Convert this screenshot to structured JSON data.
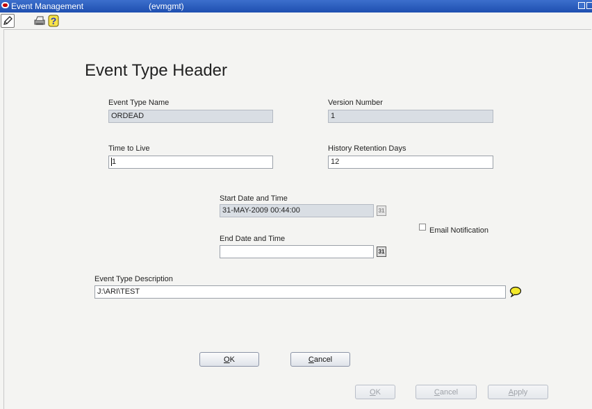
{
  "window": {
    "title": "Event Management",
    "code": "(evmgmt)"
  },
  "toolbar": {
    "items": [
      {
        "icon": "edit-icon"
      },
      {
        "icon": "printer-icon"
      },
      {
        "icon": "help-icon",
        "glyph": "?"
      }
    ]
  },
  "form": {
    "heading": "Event Type Header",
    "event_type_name": {
      "label": "Event Type Name",
      "value": "ORDEAD"
    },
    "version_number": {
      "label": "Version Number",
      "value": "1"
    },
    "time_to_live": {
      "label": "Time to Live",
      "value": "1"
    },
    "history_retention_days": {
      "label": "History Retention Days",
      "value": "12"
    },
    "start_date_time": {
      "label": "Start Date and Time",
      "value": "31-MAY-2009 00:44:00"
    },
    "email_notification": {
      "label": "Email Notification",
      "checked": false
    },
    "end_date_time": {
      "label": "End Date and Time",
      "value": ""
    },
    "description": {
      "label": "Event Type Description",
      "value": "J:\\ARI\\TEST"
    },
    "calendar_glyph": "31"
  },
  "buttons": {
    "ok": {
      "accel": "O",
      "rest": "K"
    },
    "cancel": {
      "accel": "C",
      "rest": "ancel"
    },
    "footer_ok": {
      "accel": "O",
      "rest": "K"
    },
    "footer_cancel": {
      "accel": "C",
      "rest": "ancel"
    },
    "footer_apply": {
      "accel": "A",
      "rest": "pply"
    }
  },
  "colors": {
    "titlebar": "#1e4fb0",
    "readonly_field": "#d9dee4",
    "background": "#f4f4f2"
  }
}
